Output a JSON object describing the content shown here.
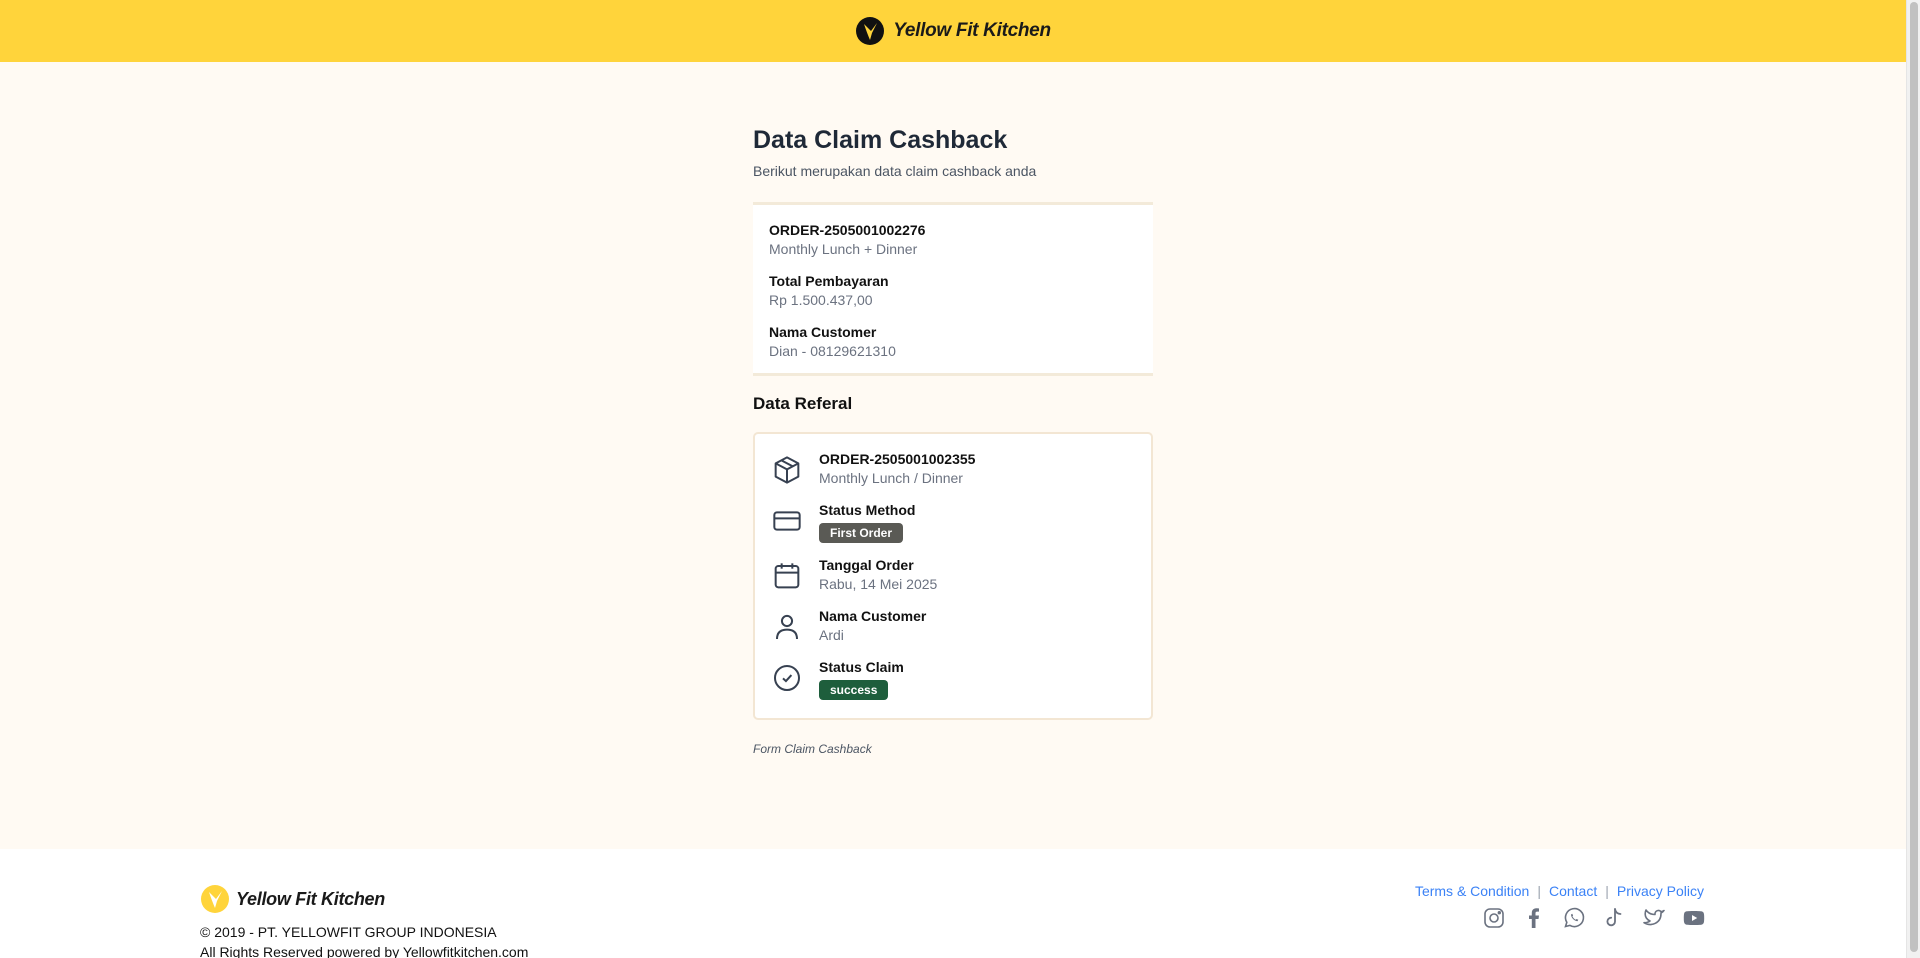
{
  "header": {
    "brand": "Yellow Fit Kitchen"
  },
  "page": {
    "title": "Data Claim Cashback",
    "subtitle": "Berikut merupakan data claim cashback anda"
  },
  "claim": {
    "order_id": "ORDER-2505001002276",
    "order_package": "Monthly Lunch + Dinner",
    "total_label": "Total Pembayaran",
    "total_value": "Rp 1.500.437,00",
    "customer_label": "Nama Customer",
    "customer_value": "Dian - 08129621310"
  },
  "referral": {
    "section_title": "Data Referal",
    "order_id": "ORDER-2505001002355",
    "order_package": "Monthly Lunch / Dinner",
    "status_method_label": "Status Method",
    "status_method_badge": "First Order",
    "order_date_label": "Tanggal Order",
    "order_date_value": "Rabu, 14 Mei 2025",
    "customer_label": "Nama Customer",
    "customer_value": "Ardi",
    "status_claim_label": "Status Claim",
    "status_claim_badge": "success",
    "icons": [
      "box-icon",
      "credit-card-icon",
      "calendar-icon",
      "user-icon",
      "check-circle-icon"
    ]
  },
  "form_link": "Form Claim Cashback",
  "footer": {
    "brand": "Yellow Fit Kitchen",
    "copyright_line1": "© 2019 - PT. YELLOWFIT GROUP INDONESIA",
    "copyright_line2": "All Rights Reserved powered by Yellowfitkitchen.com",
    "links": [
      "Terms & Condition",
      "Contact",
      "Privacy Policy"
    ],
    "separator": "|",
    "social_icons": [
      "instagram-icon",
      "facebook-icon",
      "whatsapp-icon",
      "tiktok-icon",
      "twitter-icon",
      "youtube-icon"
    ]
  },
  "colors": {
    "header_bg": "#ffd43b",
    "page_bg": "#fffaf3",
    "badge_grey": "#5a5a55",
    "badge_success": "#1e5e3c",
    "link": "#3b82f6"
  }
}
